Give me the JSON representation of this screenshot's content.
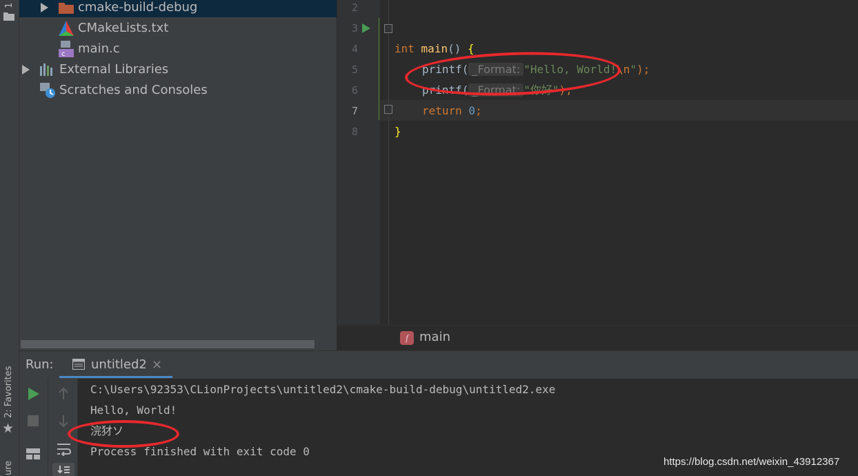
{
  "left_strip": {
    "project_tab": "1",
    "favorites_tab": "2: Favorites",
    "structure_tab": "ure"
  },
  "project_tree": {
    "items": [
      {
        "label": "cmake-build-debug",
        "kind": "folder",
        "expanded": false,
        "selected": true
      },
      {
        "label": "CMakeLists.txt",
        "kind": "cmake-file"
      },
      {
        "label": "main.c",
        "kind": "c-file"
      },
      {
        "label": "External Libraries",
        "kind": "library",
        "expanded": false
      },
      {
        "label": "Scratches and Consoles",
        "kind": "scratches"
      }
    ]
  },
  "editor": {
    "line_numbers": [
      "2",
      "3",
      "4",
      "5",
      "6",
      "7",
      "8"
    ],
    "lines": {
      "l3": {
        "kw": "int",
        "fn": "main",
        "rest": "() ",
        "brace": "{"
      },
      "l4": {
        "call": "printf(",
        "hint": "_Format:",
        "str": "\"Hello, World!",
        "esc": "\\n",
        "str_end": "\"",
        "tail": ");"
      },
      "l5": {
        "call": "printf(",
        "hint": "_Format:",
        "str": "\"你好\"",
        "tail": ");"
      },
      "l6": {
        "kw": "return",
        "num": " 0",
        "tail": ";"
      },
      "l7": {
        "brace": "}"
      }
    },
    "breadcrumb": {
      "badge": "f",
      "label": "main"
    }
  },
  "run_panel": {
    "title": "Run:",
    "tab_label": "untitled2",
    "tab_close": "×",
    "console_lines": [
      "C:\\Users\\92353\\CLionProjects\\untitled2\\cmake-build-debug\\untitled2.exe",
      "Hello, World!",
      "浣犲ソ",
      "Process finished with exit code 0"
    ]
  },
  "watermark": "https://blog.csdn.net/weixin_43912367",
  "colors": {
    "annotation": "#e8282c",
    "keyword": "#cc7832",
    "function": "#ffc66d",
    "string": "#6a8759",
    "accent": "#4a88c7"
  }
}
